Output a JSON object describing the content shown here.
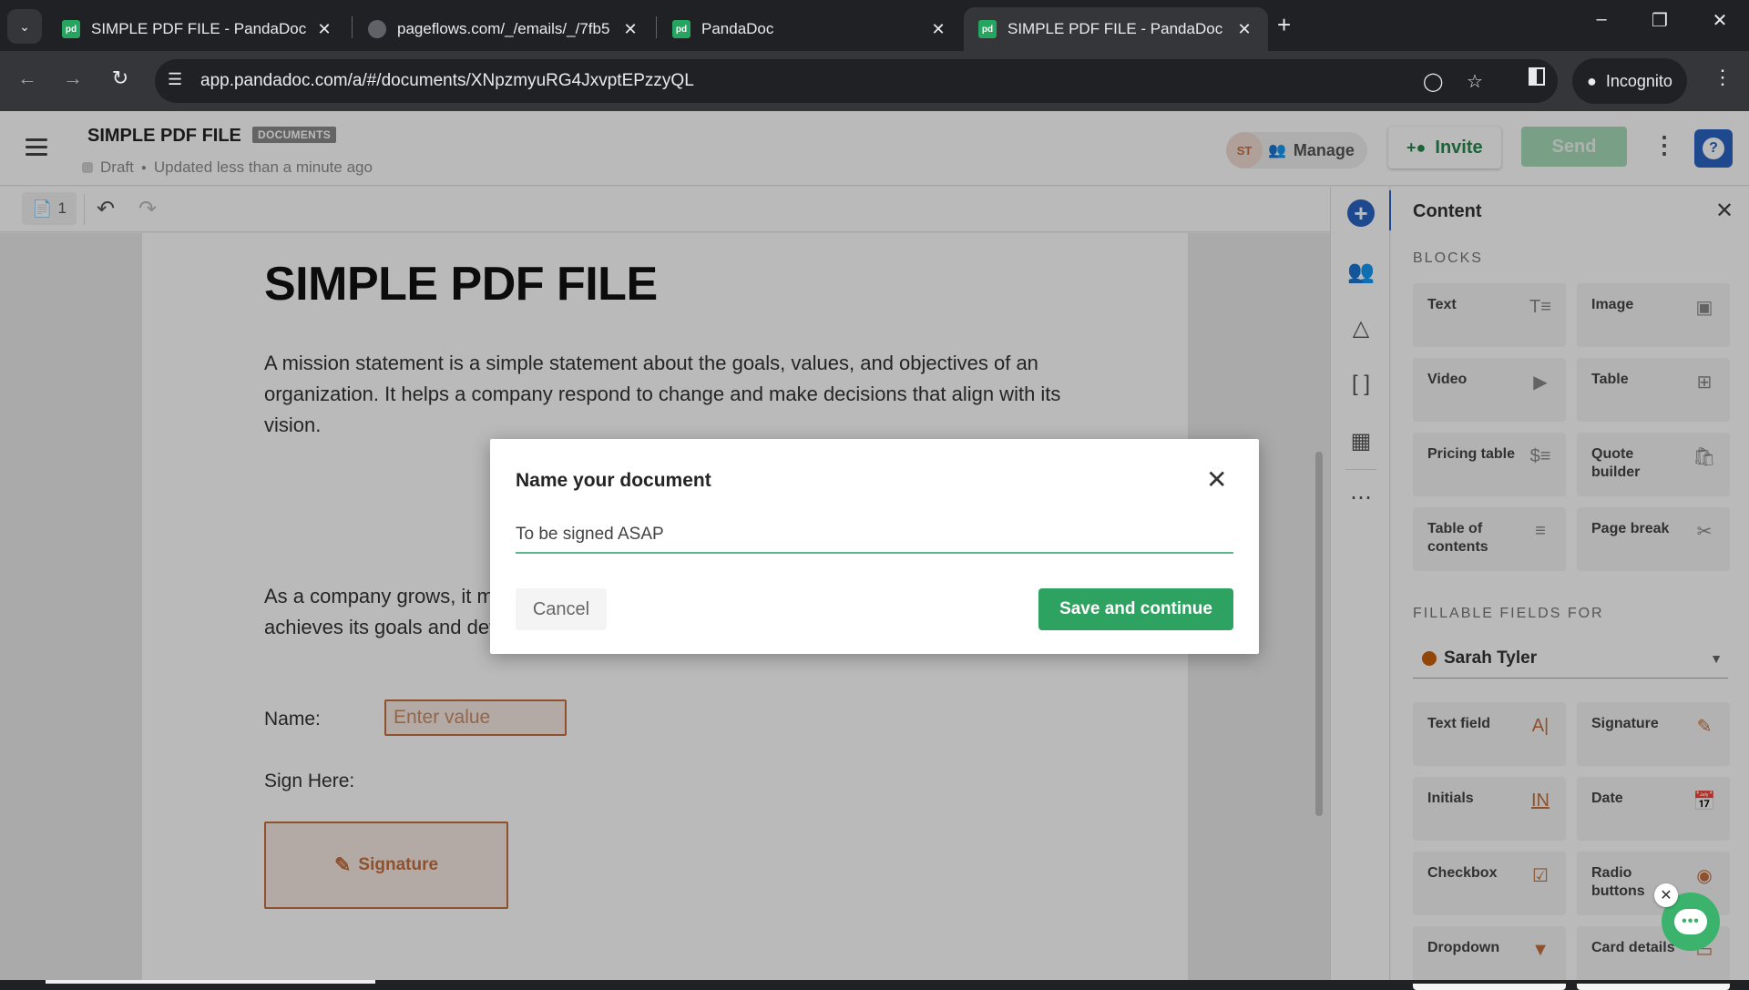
{
  "browser": {
    "tabs": [
      {
        "title": "SIMPLE PDF FILE - PandaDoc",
        "favicon": "pandadoc-icon",
        "active": false
      },
      {
        "title": "pageflows.com/_/emails/_/7fb5",
        "favicon": "globe-icon",
        "active": false
      },
      {
        "title": "PandaDoc",
        "favicon": "pandadoc-icon",
        "active": false
      },
      {
        "title": "SIMPLE PDF FILE - PandaDoc",
        "favicon": "pandadoc-icon",
        "active": true
      }
    ],
    "favicon_text": "pd",
    "url": "app.pandadoc.com/a/#/documents/XNpzmyuRG4JxvptEPzzyQL",
    "incognito_label": "Incognito"
  },
  "header": {
    "doc_title": "SIMPLE PDF FILE",
    "badge": "DOCUMENTS",
    "status": "Draft",
    "updated": "Updated less than a minute ago",
    "avatar_initials": "ST",
    "manage_label": "Manage",
    "invite_label": "Invite",
    "send_label": "Send",
    "help_label": "?"
  },
  "editor_toolbar": {
    "page_count": "1"
  },
  "document": {
    "title": "SIMPLE PDF FILE",
    "paragraph1": "A mission statement is a simple statement about the goals, values, and objectives of an organization. It helps a company respond to change and make decisions that align with its vision.",
    "paragraph2": "As a company grows, it may need to revise mission statements to ensure the company achieves its goals and develops.",
    "name_label": "Name:",
    "name_placeholder": "Enter value",
    "sign_label": "Sign Here:",
    "signature_label": "Signature"
  },
  "panel": {
    "title": "Content",
    "blocks_label": "BLOCKS",
    "blocks": [
      {
        "label": "Text",
        "icon": "text-icon"
      },
      {
        "label": "Image",
        "icon": "image-icon"
      },
      {
        "label": "Video",
        "icon": "video-icon"
      },
      {
        "label": "Table",
        "icon": "table-icon"
      },
      {
        "label": "Pricing table",
        "icon": "pricing-table-icon"
      },
      {
        "label": "Quote builder",
        "icon": "shopping-bag-icon"
      },
      {
        "label": "Table of contents",
        "icon": "toc-icon"
      },
      {
        "label": "Page break",
        "icon": "scissors-icon"
      }
    ],
    "fillable_label": "FILLABLE FIELDS FOR",
    "recipient": {
      "name": "Sarah Tyler",
      "color": "#c9600a"
    },
    "fields": [
      {
        "label": "Text field",
        "icon": "text-field-icon"
      },
      {
        "label": "Signature",
        "icon": "signature-icon"
      },
      {
        "label": "Initials",
        "icon": "initials-icon"
      },
      {
        "label": "Date",
        "icon": "calendar-icon"
      },
      {
        "label": "Checkbox",
        "icon": "checkbox-icon"
      },
      {
        "label": "Radio buttons",
        "icon": "radio-icon"
      },
      {
        "label": "Dropdown",
        "icon": "dropdown-icon"
      },
      {
        "label": "Card details",
        "icon": "card-icon"
      }
    ]
  },
  "modal": {
    "title": "Name your document",
    "input_value": "To be signed ASAP",
    "cancel_label": "Cancel",
    "save_label": "Save and continue"
  },
  "colors": {
    "brand_green": "#2ea260",
    "accent_blue": "#2a64c4",
    "recipient_orange": "#c4703e"
  }
}
